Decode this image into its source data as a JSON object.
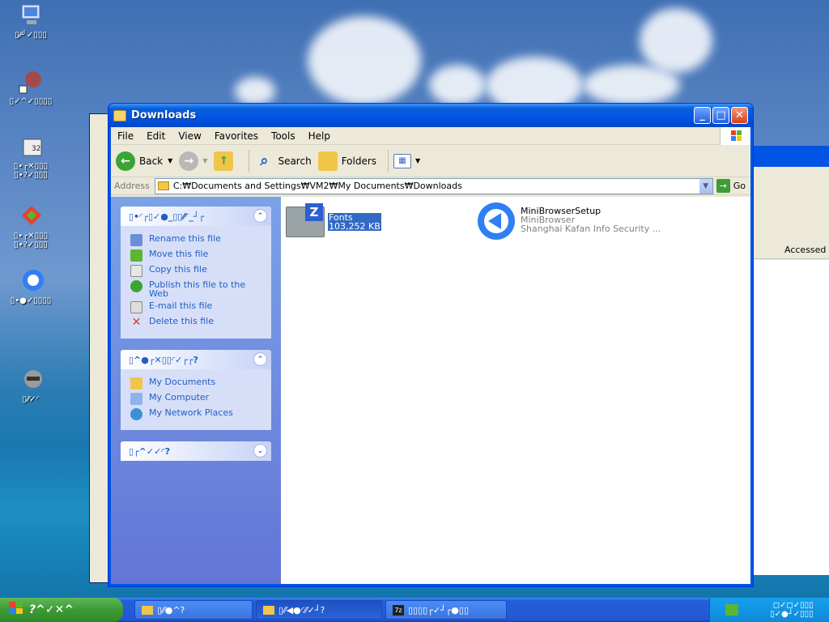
{
  "desktop": {
    "icons": [
      {
        "label": "▯⁄⁄╯✓▯▯▯"
      },
      {
        "label": "▯✓^✓▯▯▯▯"
      },
      {
        "label": "▯•┌✕▯▯▯\n▯•?✓▯▯▯"
      },
      {
        "label": "▯•┌✕▯▯▯\n▯•?✓▯▯▯"
      },
      {
        "label": "▯•●✓▯▯▯▯"
      },
      {
        "label": "▯⁄⁄✓◜"
      }
    ]
  },
  "window": {
    "title": "Downloads",
    "menu": [
      "File",
      "Edit",
      "View",
      "Favorites",
      "Tools",
      "Help"
    ],
    "toolbar": {
      "back": "Back",
      "search": "Search",
      "folders": "Folders"
    },
    "address": {
      "label": "Address",
      "value": "C:₩Documents and Settings₩VM2₩My Documents₩Downloads",
      "go": "Go"
    },
    "panels": [
      {
        "title": "▯•◜┌▯✓●_▯▯⁄⁄◜_┘┌",
        "items": [
          "Rename this file",
          "Move this file",
          "Copy this file",
          "Publish this file to the Web",
          "E-mail this file",
          "Delete this file"
        ]
      },
      {
        "title": "▯^●┌✕▯▯◜✓┌┌?",
        "items": [
          "My Documents",
          "My Computer",
          "My Network Places"
        ]
      },
      {
        "title": "▯┌^✓✓◜?",
        "items": []
      }
    ],
    "files": [
      {
        "name": "Fonts",
        "size": "103,252 KB"
      },
      {
        "name": "MiniBrowserSetup",
        "product": "MiniBrowser",
        "company": "Shanghai Kafan Info Security ..."
      }
    ]
  },
  "background_window": {
    "column": "Accessed"
  },
  "taskbar": {
    "start": "?^✓✕^",
    "buttons": [
      "▯⁄⁄●^?",
      "▯⁄⁄◀●◜⁄⁄✓┘?",
      "▯▯▯▯┌✓┘┌●▯▯"
    ],
    "tray_lines": [
      "◻✓◻✓▯▯▯",
      "▯✓●┘✓▯▯▯"
    ]
  },
  "colors": {
    "link": "#215dc6",
    "title_blue": "#0054e3"
  }
}
